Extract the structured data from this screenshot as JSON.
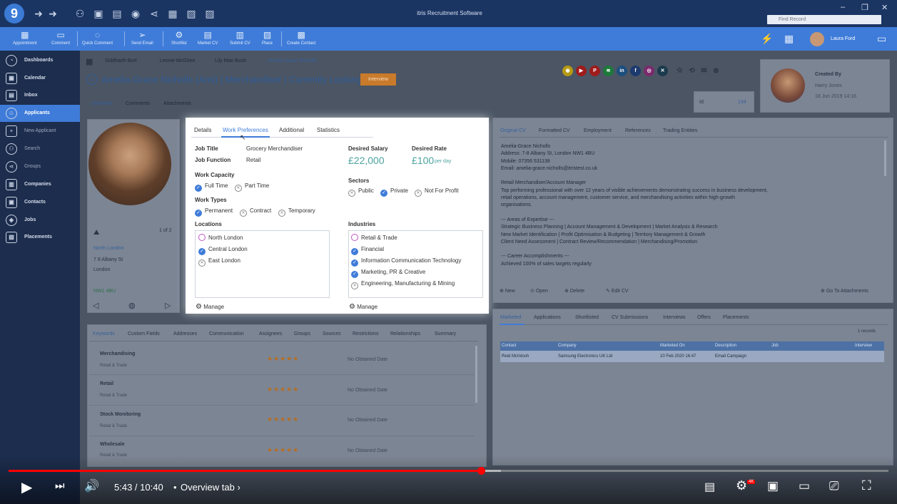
{
  "window": {
    "title": "itris Recruitment Software",
    "find_placeholder": "Find Record",
    "logo": "9"
  },
  "toolbar": {
    "buttons": [
      "Appointment",
      "Comment",
      "Quick Comment",
      "Send Email",
      "Shortlist",
      "Market CV",
      "Submit CV",
      "Place",
      "Create Contact"
    ],
    "user": "Laura Ford"
  },
  "sidebar": {
    "items": [
      {
        "label": "Dashboards",
        "icon": "dashboard-icon"
      },
      {
        "label": "Calendar",
        "icon": "calendar-icon"
      },
      {
        "label": "Inbox",
        "icon": "inbox-icon"
      },
      {
        "label": "Applicants",
        "icon": "applicants-icon",
        "active": true
      },
      {
        "label": "New Applicant",
        "icon": "new-applicant-icon",
        "sub": true
      },
      {
        "label": "Search",
        "icon": "binoculars-icon",
        "sub": true
      },
      {
        "label": "Groups",
        "icon": "groups-icon",
        "sub": true
      },
      {
        "label": "Companies",
        "icon": "companies-icon"
      },
      {
        "label": "Contacts",
        "icon": "contacts-icon"
      },
      {
        "label": "Jobs",
        "icon": "jobs-icon"
      },
      {
        "label": "Placements",
        "icon": "placements-icon"
      }
    ]
  },
  "recent_tabs": [
    "Siddharth Burt",
    "Leonie McGhee",
    "Lily Mae Bush",
    "Amelia Grace Nicholls"
  ],
  "applicant": {
    "header": "Amelia-Grace Nicholls (Ami) | Merchandiser | Currently Looking",
    "status": "Interview",
    "subtabs": [
      "Overview",
      "Comments",
      "Attachments"
    ],
    "created_by_label": "Created By",
    "created_by": "Harry Jones",
    "created_on": "18 Jun 2019 14:16",
    "id_label": "Id",
    "id": "134"
  },
  "address": {
    "counter": "1 of 2",
    "area": "North London",
    "line1": "7 8 Albany St",
    "line2": "London",
    "postcode": "NW1 4BU"
  },
  "prefs": {
    "tabs": [
      "Details",
      "Work Preferences",
      "Additional",
      "Statistics"
    ],
    "job_title_label": "Job Title",
    "job_title": "Grocery Merchandiser",
    "job_function_label": "Job Function",
    "job_function": "Retail",
    "desired_salary_label": "Desired Salary",
    "desired_salary": "£22,000",
    "desired_rate_label": "Desired Rate",
    "desired_rate": "£100",
    "desired_rate_unit": "per day",
    "work_capacity_label": "Work Capacity",
    "full_time": "Full Time",
    "part_time": "Part Time",
    "sectors_label": "Sectors",
    "public": "Public",
    "private": "Private",
    "not_for_profit": "Not For Profit",
    "work_types_label": "Work Types",
    "permanent": "Permanent",
    "contract": "Contract",
    "temporary": "Temporary",
    "locations_label": "Locations",
    "locations": [
      "North London",
      "Central London",
      "East London"
    ],
    "industries_label": "Industries",
    "industries": [
      "Retail & Trade",
      "Financial",
      "Information Communication Technology",
      "Marketing, PR & Creative",
      "Engineering, Manufacturing & Mining"
    ],
    "manage": "Manage"
  },
  "cv": {
    "tabs": [
      "Original CV",
      "Formatted CV",
      "Employment",
      "References",
      "Trading Entities"
    ],
    "lines": [
      "Amelia-Grace Nicholls",
      "Address: 7-8 Albany St, London NW1 4BU",
      "Mobile: 07356 531138",
      "Email: amelia-grace.nicholls@itristest.co.uk",
      "",
      "Retail Merchandiser/Account Manager",
      "Top performing professional with over 12 years of visible achievements demonstrating success in business development,",
      "retail operations, account management, customer service, and merchandising activities within high-growth",
      "organisations.",
      "",
      "--- Areas of Expertise ---",
      "Strategic Business Planning | Account Management & Development | Market Analysis & Research",
      "New Market Identification | Profit Optimisation & Budgeting | Territory Management & Growth",
      "Client Need Assessment | Contract Review/Recommendation | Merchandising/Promotion",
      "",
      "--- Career Accomplishments ---",
      "Achieved 100% of sales targets regularly"
    ],
    "actions": [
      "New",
      "Open",
      "Delete",
      "Edit CV",
      "Go To Attachments"
    ]
  },
  "marketing": {
    "tabs": [
      "Marketed",
      "Applications",
      "Shortlisted",
      "CV Submissions",
      "Interviews",
      "Offers",
      "Placements"
    ],
    "records": "1 records",
    "columns": [
      "Contact",
      "Company",
      "Marketed On",
      "Description",
      "Job",
      "Interview"
    ],
    "row": [
      "Reid McIntosh",
      "Samsung Electronics UK Ltd",
      "10 Feb 2020 16:47",
      "Email Campaign",
      "",
      ""
    ]
  },
  "keywords": {
    "tabs": [
      "Keywords",
      "Custom Fields",
      "Addresses",
      "Communication",
      "Assignees",
      "Groups",
      "Sources",
      "Restrictions",
      "Relationships",
      "Summary"
    ],
    "items": [
      {
        "name": "Merchandising",
        "category": "Retail & Trade",
        "rating": 5,
        "date": "No Obtained Date"
      },
      {
        "name": "Retail",
        "category": "Retail & Trade",
        "rating": 5,
        "date": "No Obtained Date"
      },
      {
        "name": "Stock Monitoring",
        "category": "Retail & Trade",
        "rating": 5,
        "date": "No Obtained Date"
      },
      {
        "name": "Wholesale",
        "category": "Retail & Trade",
        "rating": 5,
        "date": "No Obtained Date"
      }
    ]
  },
  "player": {
    "time": "5:43 / 10:40",
    "separator": "•",
    "chapter": "Overview tab",
    "quality": "4K",
    "progress": 0.537
  }
}
